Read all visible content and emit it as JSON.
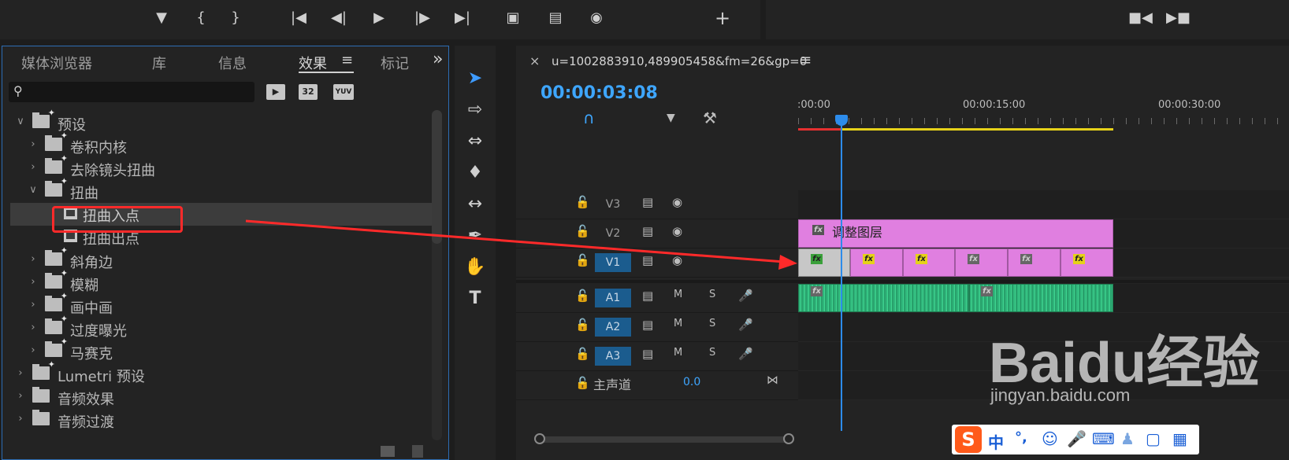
{
  "transport": {
    "buttons": [
      "marker-icon",
      "mark-in-icon",
      "mark-out-icon",
      "go-to-in-icon",
      "step-back-icon",
      "play-icon",
      "step-forward-icon",
      "go-to-out-icon",
      "insert-icon",
      "overwrite-icon",
      "camera-icon",
      "add-icon"
    ],
    "right_buttons": [
      "lift-icon",
      "extract-icon"
    ]
  },
  "effects_panel": {
    "tabs": [
      {
        "label": "媒体浏览器",
        "active": false
      },
      {
        "label": "库",
        "active": false
      },
      {
        "label": "信息",
        "active": false
      },
      {
        "label": "效果",
        "active": true
      },
      {
        "label": "标记",
        "active": false
      }
    ],
    "overflow_glyph": "»",
    "menu_glyph": "≡",
    "search": {
      "placeholder": "",
      "value": ""
    },
    "filter_buttons": [
      "▶",
      "32",
      "YUV"
    ],
    "tree": [
      {
        "label": "预设",
        "level": 0,
        "expanded": true,
        "kind": "folder"
      },
      {
        "label": "卷积内核",
        "level": 1,
        "expanded": false,
        "kind": "folder"
      },
      {
        "label": "去除镜头扭曲",
        "level": 1,
        "expanded": false,
        "kind": "folder"
      },
      {
        "label": "扭曲",
        "level": 1,
        "expanded": true,
        "kind": "folder"
      },
      {
        "label": "扭曲入点",
        "level": 2,
        "kind": "preset",
        "selected": true
      },
      {
        "label": "扭曲出点",
        "level": 2,
        "kind": "preset"
      },
      {
        "label": "斜角边",
        "level": 1,
        "expanded": false,
        "kind": "folder"
      },
      {
        "label": "模糊",
        "level": 1,
        "expanded": false,
        "kind": "folder"
      },
      {
        "label": "画中画",
        "level": 1,
        "expanded": false,
        "kind": "folder"
      },
      {
        "label": "过度曝光",
        "level": 1,
        "expanded": false,
        "kind": "folder"
      },
      {
        "label": "马赛克",
        "level": 1,
        "expanded": false,
        "kind": "folder"
      },
      {
        "label": "Lumetri 预设",
        "level": 0,
        "expanded": false,
        "kind": "folder"
      },
      {
        "label": "音频效果",
        "level": 0,
        "expanded": false,
        "kind": "folder"
      },
      {
        "label": "音频过渡",
        "level": 0,
        "expanded": false,
        "kind": "folder"
      }
    ]
  },
  "timeline": {
    "close_glyph": "×",
    "sequence_name": "u=1002883910,489905458&fm=26&gp=0",
    "menu_glyph": "≡",
    "timecode": "00:00:03:08",
    "ruler_labels": [
      ":00:00",
      "00:00:15:00",
      "00:00:30:00"
    ],
    "video_tracks": [
      "V3",
      "V2",
      "V1"
    ],
    "audio_tracks": [
      "A1",
      "A2",
      "A3"
    ],
    "track_toggles": {
      "mute": "M",
      "solo": "S"
    },
    "master_label": "主声道",
    "master_value": "0.0",
    "adjustment_clip_label": "调整图层",
    "fx_badge": "fx"
  },
  "colors": {
    "accent_blue": "#2d8ceb",
    "timecode_blue": "#3ea6ff",
    "adjustment_pink": "#e07fe0",
    "audio_green": "#2fb57a",
    "highlight_red": "#ff2a2a",
    "track_target_blue": "#1b5c8e"
  },
  "watermark": {
    "brand": "Baidu经验",
    "url": "jingyan.baidu.com"
  },
  "ime_toolbar": {
    "logo": "S",
    "lang": "中",
    "punct": "°,",
    "icons": [
      "emoji-icon",
      "mic-icon",
      "keyboard-icon",
      "user-icon",
      "shirt-icon",
      "grid-icon"
    ]
  }
}
